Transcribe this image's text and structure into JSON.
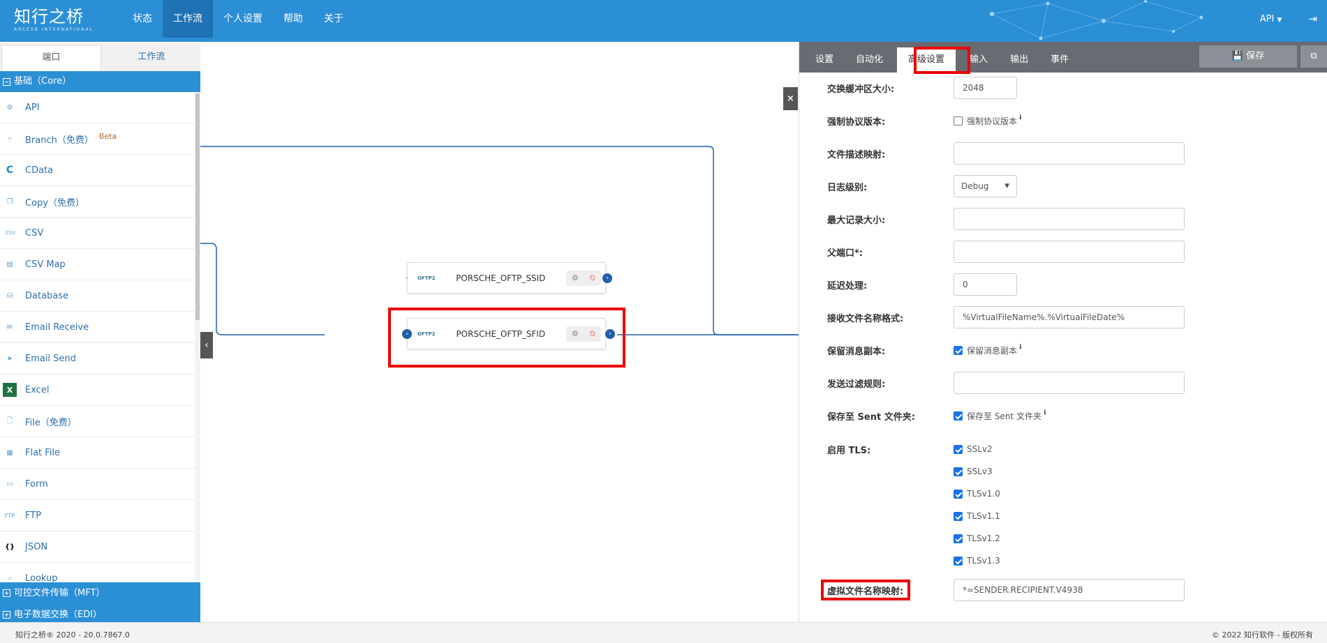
{
  "header": {
    "logo_cn": "知行之桥",
    "logo_en": "ARCESB INTERNATIONAL",
    "nav": [
      {
        "label": "状态"
      },
      {
        "label": "工作流"
      },
      {
        "label": "个人设置"
      },
      {
        "label": "帮助"
      },
      {
        "label": "关于"
      }
    ],
    "active_nav": "工作流",
    "user_menu": "API",
    "accent": "#2b8fd6"
  },
  "sidebar": {
    "tabs": [
      {
        "label": "端口"
      },
      {
        "label": "工作流"
      }
    ],
    "group_core": "基础（Core）",
    "items": [
      {
        "label": "API",
        "icon": "api-gear-icon"
      },
      {
        "label": "Branch（免费）",
        "icon": "branch-icon",
        "badge": "Beta"
      },
      {
        "label": "CData",
        "icon": "cdata-icon"
      },
      {
        "label": "Copy（免费）",
        "icon": "copy-icon"
      },
      {
        "label": "CSV",
        "icon": "csv-icon"
      },
      {
        "label": "CSV Map",
        "icon": "csv-map-icon"
      },
      {
        "label": "Database",
        "icon": "database-icon"
      },
      {
        "label": "Email Receive",
        "icon": "email-receive-icon"
      },
      {
        "label": "Email Send",
        "icon": "email-send-icon"
      },
      {
        "label": "Excel",
        "icon": "excel-icon"
      },
      {
        "label": "File（免费）",
        "icon": "file-icon"
      },
      {
        "label": "Flat File",
        "icon": "flat-file-icon"
      },
      {
        "label": "Form",
        "icon": "form-icon"
      },
      {
        "label": "FTP",
        "icon": "ftp-icon"
      },
      {
        "label": "JSON",
        "icon": "json-icon"
      },
      {
        "label": "Lookup",
        "icon": "lookup-icon"
      }
    ],
    "group_mft": "可控文件传输（MFT）",
    "group_edi": "电子数据交换（EDI）"
  },
  "canvas": {
    "nodes": [
      {
        "tag": "OFTP2",
        "name": "PORSCHE_OFTP_SSID"
      },
      {
        "tag": "OFTP2",
        "name": "PORSCHE_OFTP_SFID"
      }
    ]
  },
  "panel": {
    "tabs": [
      {
        "label": "设置"
      },
      {
        "label": "自动化"
      },
      {
        "label": "高级设置"
      },
      {
        "label": "输入"
      },
      {
        "label": "输出"
      },
      {
        "label": "事件"
      }
    ],
    "save_label": "保存",
    "fields": {
      "buffer_size": {
        "label": "交换缓冲区大小:",
        "value": "2048"
      },
      "force_protocol": {
        "label": "强制协议版本:",
        "checkbox_label": "强制协议版本"
      },
      "file_desc_map": {
        "label": "文件描述映射:",
        "value": ""
      },
      "log_level": {
        "label": "日志级别:",
        "value": "Debug"
      },
      "max_record": {
        "label": "最大记录大小:",
        "value": ""
      },
      "parent_port": {
        "label": "父端口*:",
        "value": ""
      },
      "delay": {
        "label": "延迟处理:",
        "value": "0"
      },
      "recv_name_fmt": {
        "label": "接收文件名称格式:",
        "value": "%VirtualFileName%.%VirtualFileDate%"
      },
      "keep_copy": {
        "label": "保留消息副本:",
        "checkbox_label": "保留消息副本"
      },
      "send_filter": {
        "label": "发送过滤规则:",
        "value": ""
      },
      "save_sent": {
        "label": "保存至 Sent 文件夹:",
        "checkbox_label": "保存至 Sent 文件夹"
      },
      "tls": {
        "label": "启用 TLS:",
        "options": [
          "SSLv2",
          "SSLv3",
          "TLSv1.0",
          "TLSv1.1",
          "TLSv1.2",
          "TLSv1.3"
        ]
      },
      "virtual_name_map": {
        "label": "虚拟文件名称映射:",
        "value": "*=SENDER.RECIPIENT.V4938"
      }
    }
  },
  "footer": {
    "left": "知行之桥® 2020 - 20.0.7867.0",
    "right": "© 2022 知行软件 - 版权所有"
  }
}
